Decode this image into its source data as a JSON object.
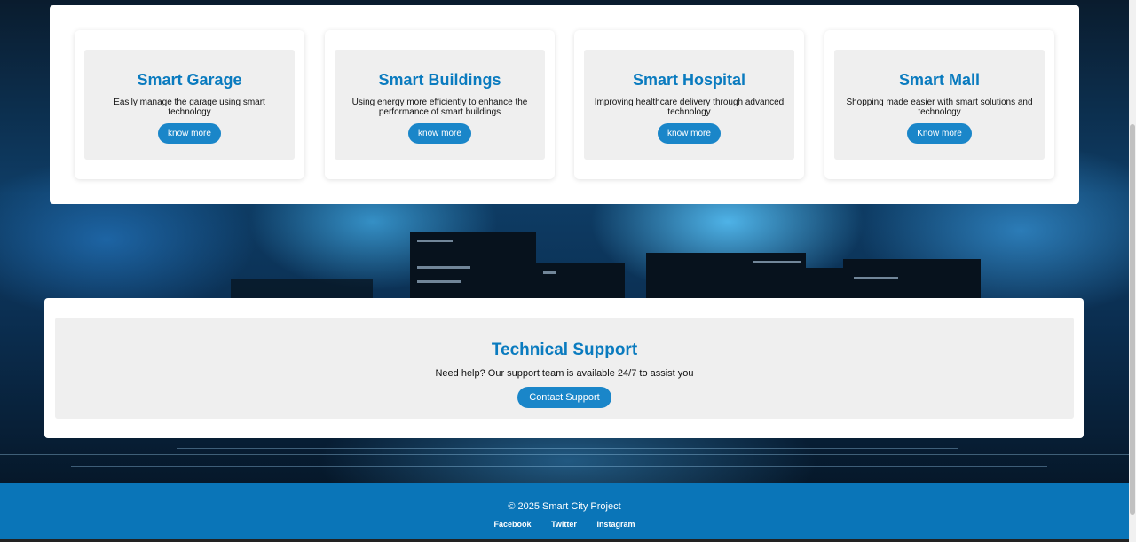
{
  "services": [
    {
      "title": "Smart Garage",
      "description": "Easily manage the garage using smart technology",
      "button": "know more"
    },
    {
      "title": "Smart Buildings",
      "description": "Using energy more efficiently to enhance the performance of smart buildings",
      "button": "know more"
    },
    {
      "title": "Smart Hospital",
      "description": "Improving healthcare delivery through advanced technology",
      "button": "know more"
    },
    {
      "title": "Smart Mall",
      "description": "Shopping made easier with smart solutions and technology",
      "button": "Know more"
    }
  ],
  "support": {
    "title": "Technical Support",
    "description": "Need help? Our support team is available 24/7 to assist you",
    "button": "Contact Support"
  },
  "footer": {
    "copyright": "© 2025 Smart City Project",
    "links": [
      "Facebook",
      "Twitter",
      "Instagram"
    ]
  },
  "colors": {
    "accent": "#0a7bbf",
    "button": "#1a86c9",
    "footer": "#0a75b8"
  }
}
